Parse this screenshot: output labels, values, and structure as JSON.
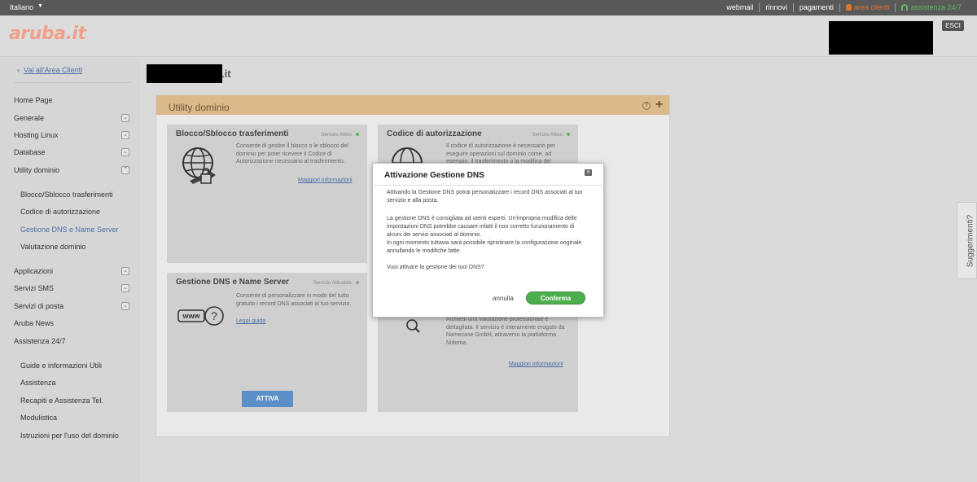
{
  "topbar": {
    "language": "Italiano",
    "links": {
      "webmail": "webmail",
      "rinnovi": "rinnovi",
      "pagamenti": "pagamenti",
      "area_clienti": "area clienti",
      "assistenza": "assistenza 24/7"
    }
  },
  "header": {
    "logo_text": "aruba.it",
    "logout_label": "ESCI"
  },
  "sidebar": {
    "back_link": "Vai all'Area Clienti",
    "items": {
      "home": "Home Page",
      "generale": "Generale",
      "hosting": "Hosting Linux",
      "database": "Database",
      "utility": "Utility dominio",
      "sub_blocco": "Blocco/Sblocco trasferimenti",
      "sub_codice": "Codice di autorizzazione",
      "sub_dns": "Gestione DNS e Name Server",
      "sub_valutazione": "Valutazione dominio",
      "applicazioni": "Applicazioni",
      "sms": "Servizi SMS",
      "posta": "Servizi di posta",
      "news": "Aruba News",
      "assistenza": "Assistenza 24/7",
      "sub_guide": "Guide e informazioni Utili",
      "sub_assistenza": "Assistenza",
      "sub_recapiti": "Recapiti e Assistenza Tel.",
      "sub_modulistica": "Modulistica",
      "sub_istruzioni": "Istruzioni per l'uso del dominio"
    }
  },
  "main": {
    "domain_tld": ".it",
    "panel_title": "Utility dominio",
    "cards": {
      "blocco": {
        "title": "Blocco/Sblocco trasferimenti",
        "status": "Servizio Attivo",
        "desc": "Consente di gestire il blocco o le sblocco del dominio per poter ricevere il Codice di Autorizzazione necessario al trasferimento.",
        "link": "Maggiori informazioni"
      },
      "codice": {
        "title": "Codice di autorizzazione",
        "status": "Servizio Attivo",
        "desc": "Il codice di autorizzazione è necessario per eseguire operazioni sul dominio come, ad esempio, il trasferimento o la modifica del"
      },
      "dns": {
        "title": "Gestione DNS e Name Server",
        "status": "Servizio Attivabile",
        "desc": "Consente di personalizzare in modo del tutto gratuito i record DNS associati al tuo servizio.",
        "link": "Leggi guida",
        "button": "ATTIVA",
        "icon_text": "www"
      },
      "valutazione": {
        "desc": "Richiedi una valutazione professionale e dettagliata. Il servizio è interamente erogato da Namecase GmbH, attraverso la piattaforma Nidoma.",
        "link": "Maggiori informazioni"
      }
    }
  },
  "feedback_tab": "Suggerimenti?",
  "modal": {
    "title": "Attivazione Gestione DNS",
    "p1": "Attivando la Gestione DNS potrai personalizzare i record DNS associati al tuo servizio e alla posta.",
    "p2": "La gestione DNS è consigliata ad utenti esperti. Un'impropria modifica delle impostazioni DNS potrebbe causare infatti il non corretto funzionamento di alcuni dei servizi associati al dominio.",
    "p3": "In ogni momento tuttavia sarà possibile ripristinare la configurazione originale annullando le modifiche fatte.",
    "p4": "Vuoi attivare la gestione dei tuoi DNS?",
    "cancel": "annulla",
    "confirm": "Conferma"
  }
}
